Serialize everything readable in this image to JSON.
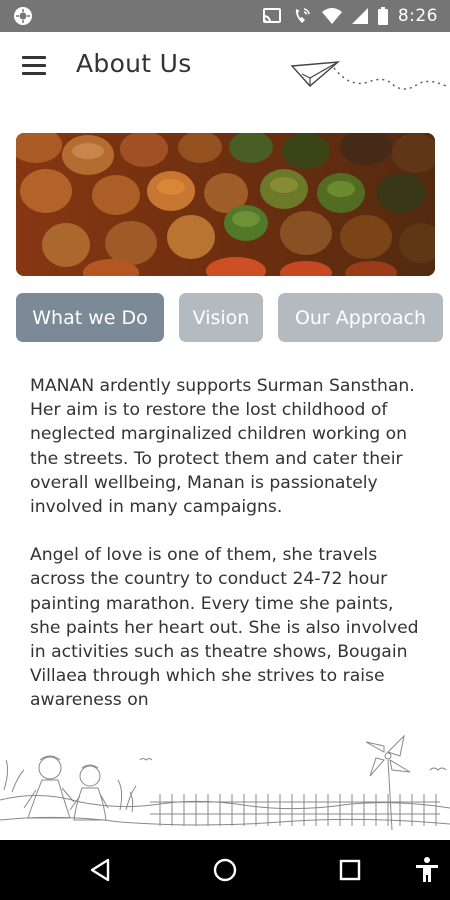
{
  "status_bar": {
    "time": "8:26",
    "icons": [
      "settings-icon",
      "cast-icon",
      "wifi-calling-icon",
      "wifi-icon",
      "signal-icon",
      "battery-icon"
    ]
  },
  "app_bar": {
    "title": "About Us",
    "menu_icon": "hamburger-menu-icon",
    "decoration": "paper-plane-icon"
  },
  "hero_image": "paint-jars-image",
  "tabs": [
    {
      "label": "What we Do",
      "active": true
    },
    {
      "label": "Vision",
      "active": false
    },
    {
      "label": "Our Approach",
      "active": false
    }
  ],
  "content": {
    "paragraphs": [
      "MANAN ardently supports Surman Sansthan. Her aim is to restore the lost childhood of neglected marginalized children working on the streets. To protect them and cater their overall wellbeing, Manan is passionately involved in many campaigns.",
      "Angel of love is one of them, she travels across the country to conduct 24-72 hour painting marathon. Every time she paints, she paints her heart out. She is also involved in activities such as theatre shows, Bougain Villaea through which she strives to raise awareness on"
    ]
  },
  "footer_illustration": "children-sketch-illustration",
  "nav_bar": {
    "buttons": [
      "back-icon",
      "home-icon",
      "recents-icon",
      "accessibility-icon"
    ]
  },
  "colors": {
    "status_bar": "#757575",
    "tab_active": "#7b8a96",
    "tab_inactive": "#b3bbc1",
    "text": "#333333",
    "nav_bar": "#000000"
  }
}
